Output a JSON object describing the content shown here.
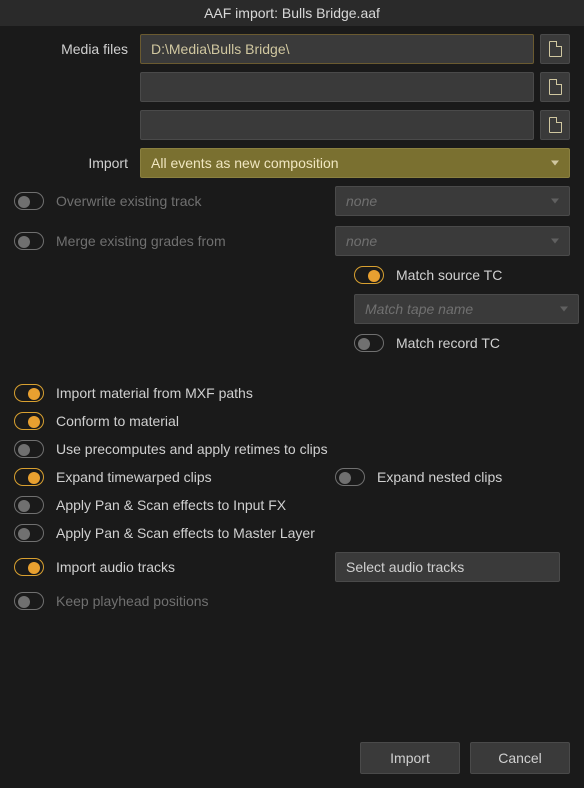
{
  "title": "AAF import: Bulls Bridge.aaf",
  "labels": {
    "media_files": "Media files",
    "import": "Import"
  },
  "paths": {
    "p1": "D:\\Media\\Bulls Bridge\\",
    "p2": "",
    "p3": ""
  },
  "import_mode": "All events as new composition",
  "options": {
    "overwrite_track": {
      "label": "Overwrite existing track",
      "on": false,
      "select": "none"
    },
    "merge_grades": {
      "label": "Merge existing grades from",
      "on": false,
      "select": "none"
    },
    "match_source_tc": {
      "label": "Match source TC",
      "on": true
    },
    "match_tape_name_select": "Match tape name",
    "match_record_tc": {
      "label": "Match record TC",
      "on": false
    },
    "import_mxf": {
      "label": "Import material from MXF paths",
      "on": true
    },
    "conform_to_material": {
      "label": "Conform to material",
      "on": true
    },
    "use_precomputes": {
      "label": "Use precomputes and apply retimes to clips",
      "on": false
    },
    "expand_timewarped": {
      "label": "Expand timewarped clips",
      "on": true
    },
    "expand_nested": {
      "label": "Expand nested clips",
      "on": false
    },
    "apply_pan_input": {
      "label": "Apply Pan & Scan effects to Input FX",
      "on": false
    },
    "apply_pan_master": {
      "label": "Apply Pan & Scan effects to Master Layer",
      "on": false
    },
    "import_audio": {
      "label": "Import audio tracks",
      "on": true,
      "button": "Select audio tracks"
    },
    "keep_playhead": {
      "label": "Keep playhead positions",
      "on": false
    }
  },
  "buttons": {
    "import": "Import",
    "cancel": "Cancel"
  }
}
